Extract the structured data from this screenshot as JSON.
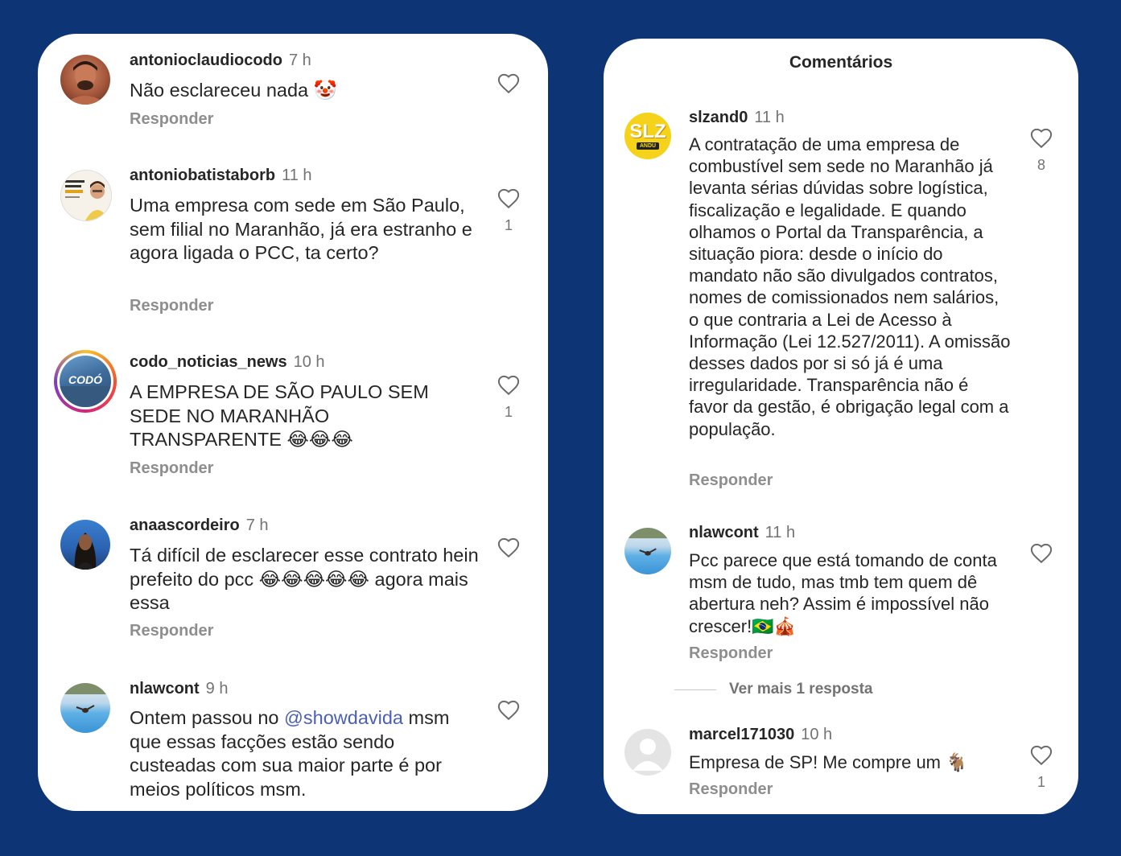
{
  "left_panel": {
    "comments": [
      {
        "username": "antonioclaudiocodo",
        "time": "7 h",
        "text": "Não esclareceu nada 🤡",
        "reply": "Responder",
        "likes": ""
      },
      {
        "username": "antoniobatistaborb",
        "time": "11 h",
        "text": "Uma empresa com sede em São Paulo, sem filial no Maranhão, já era estranho e agora ligada o PCC, ta certo?",
        "reply": "Responder",
        "likes": "1"
      },
      {
        "username": "codo_noticias_news",
        "time": "10 h",
        "text": "A EMPRESA DE SÃO PAULO SEM SEDE NO MARANHÃO TRANSPARENTE 😂😂😂",
        "reply": "Responder",
        "likes": "1",
        "avatar_label": "CODÓ"
      },
      {
        "username": "anaascordeiro",
        "time": "7 h",
        "text": "Tá difícil de esclarecer esse contrato hein prefeito do pcc 😂😂😂😂😂 agora mais essa",
        "reply": "Responder",
        "likes": ""
      },
      {
        "username": "nlawcont",
        "time": "9 h",
        "text_before": "Ontem passou no ",
        "mention": "@showdavida",
        "text_after": " msm que essas facções estão sendo custeadas com sua maior parte é por meios políticos msm.",
        "likes": ""
      }
    ]
  },
  "right_panel": {
    "title": "Comentários",
    "comments": [
      {
        "username": "slzand0",
        "time": "11 h",
        "text": "A contratação de uma empresa de combustível sem sede no Maranhão já levanta sérias dúvidas sobre logística, fiscalização e legalidade. E quando olhamos o Portal da Transparência, a situação piora: desde o início do mandato não são divulgados contratos, nomes de comissionados nem salários, o que contraria a Lei de Acesso à Informação (Lei 12.527/2011). A omissão desses dados por si só já é uma irregularidade. Transparência não é favor da gestão, é obrigação legal com a população.",
        "reply": "Responder",
        "likes": "8",
        "avatar_label": "SLZ",
        "avatar_sub": "ANDU"
      },
      {
        "username": "nlawcont",
        "time": "11 h",
        "text": "Pcc parece que está tomando de conta msm de tudo, mas tmb tem quem dê abertura neh? Assim é impossível não crescer!🇧🇷🎪",
        "reply": "Responder",
        "likes": ""
      },
      {
        "username": "marcel171030",
        "time": "10 h",
        "text": "Empresa de SP! Me compre um 🐐",
        "reply": "Responder",
        "likes": "1"
      }
    ],
    "view_more": "Ver mais 1 resposta"
  },
  "colors": {
    "background": "#0d3575",
    "panel": "#ffffff",
    "text": "#262626",
    "muted": "#8e8e8e",
    "mention": "#4a5fb5"
  }
}
